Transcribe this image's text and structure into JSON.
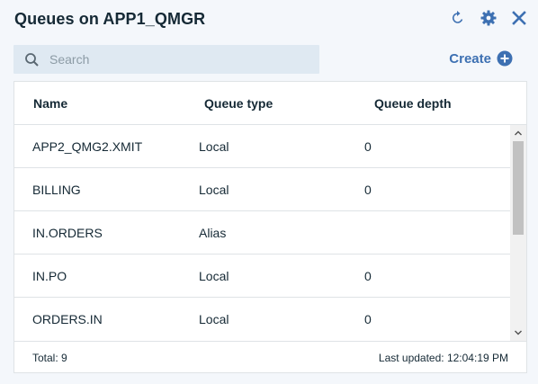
{
  "header": {
    "title": "Queues on APP1_QMGR",
    "icons": [
      "refresh-icon",
      "gear-icon",
      "close-icon"
    ]
  },
  "search": {
    "placeholder": "Search",
    "value": ""
  },
  "create": {
    "label": "Create"
  },
  "table": {
    "columns": [
      "Name",
      "Queue type",
      "Queue depth"
    ],
    "rows": [
      {
        "name": "APP2_QMG2.XMIT",
        "type": "Local",
        "depth": "0"
      },
      {
        "name": "BILLING",
        "type": "Local",
        "depth": "0"
      },
      {
        "name": "IN.ORDERS",
        "type": "Alias",
        "depth": ""
      },
      {
        "name": "IN.PO",
        "type": "Local",
        "depth": "0"
      },
      {
        "name": "ORDERS.IN",
        "type": "Local",
        "depth": "0"
      }
    ]
  },
  "footer": {
    "total": "Total: 9",
    "last_updated": "Last updated: 12:04:19 PM"
  },
  "colors": {
    "accent": "#3d70b2",
    "text": "#152935",
    "search_bg": "#dfe9f2",
    "page_bg": "#f4f7fb"
  }
}
